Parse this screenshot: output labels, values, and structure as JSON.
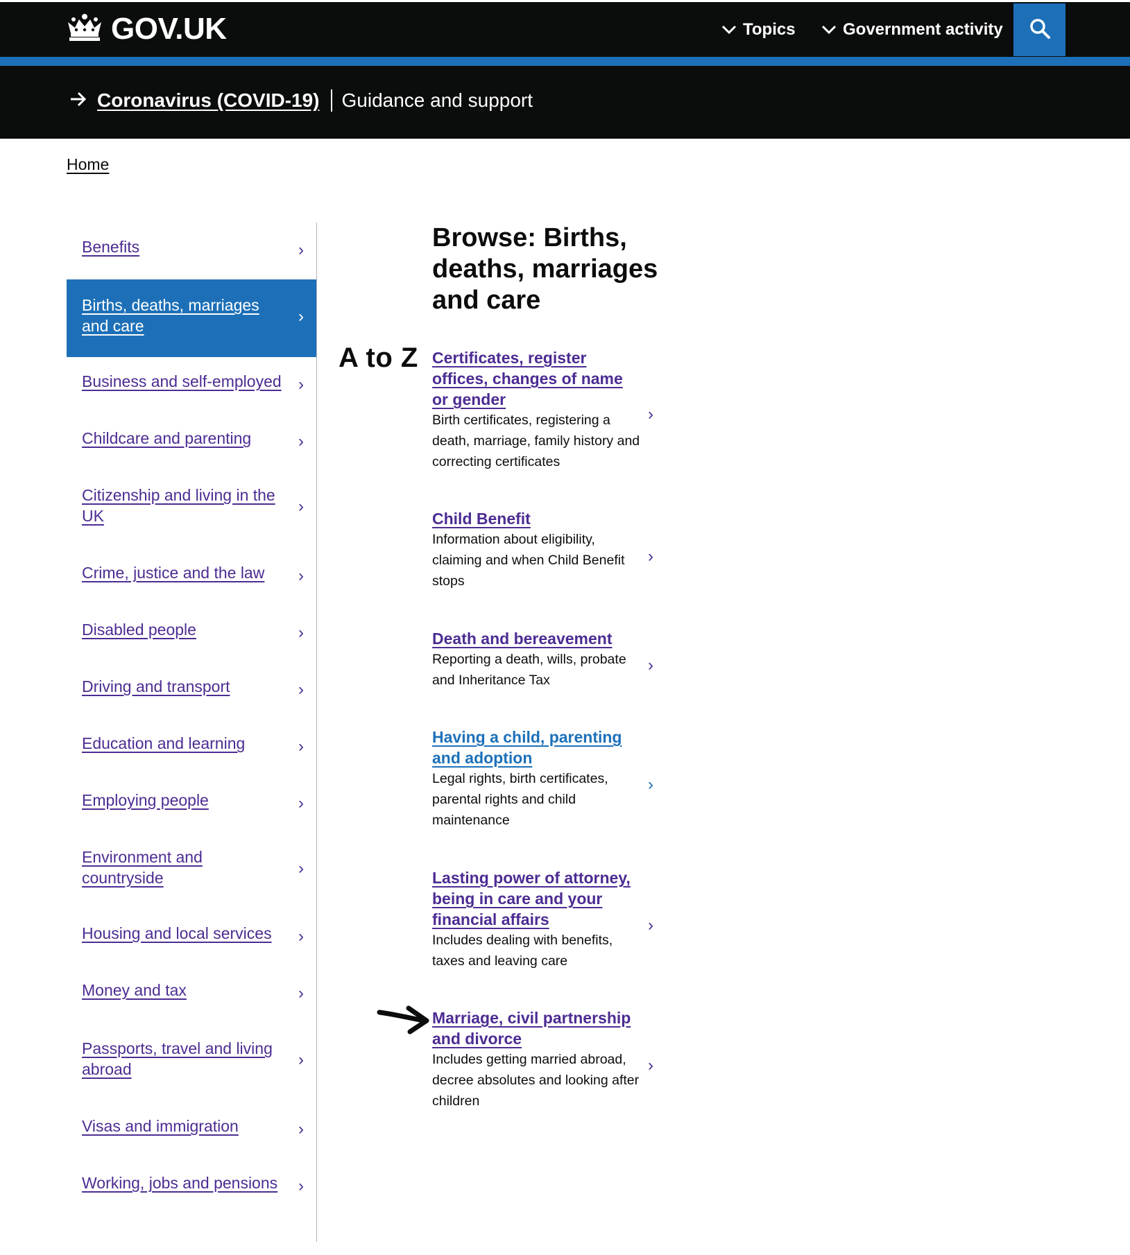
{
  "header": {
    "logo_text": "GOV.UK",
    "nav": [
      {
        "label": "Topics",
        "icon": "chevron-down-icon"
      },
      {
        "label": "Government activity",
        "icon": "chevron-down-icon"
      }
    ],
    "search_icon": "search-icon",
    "colors": {
      "bar": "#0b0c0c",
      "accent": "#1d70b8"
    }
  },
  "covid_banner": {
    "link_text": "Coronavirus (COVID-19)",
    "subtext": "Guidance and support"
  },
  "breadcrumb": {
    "home": "Home"
  },
  "sidebar": {
    "items": [
      {
        "label": "Benefits",
        "active": false
      },
      {
        "label": "Births, deaths, marriages and care",
        "active": true
      },
      {
        "label": "Business and self-employed",
        "active": false
      },
      {
        "label": "Childcare and parenting",
        "active": false
      },
      {
        "label": "Citizenship and living in the UK",
        "active": false
      },
      {
        "label": "Crime, justice and the law",
        "active": false
      },
      {
        "label": "Disabled people",
        "active": false
      },
      {
        "label": "Driving and transport",
        "active": false
      },
      {
        "label": "Education and learning",
        "active": false
      },
      {
        "label": "Employing people",
        "active": false
      },
      {
        "label": "Environment and countryside",
        "active": false
      },
      {
        "label": "Housing and local services",
        "active": false
      },
      {
        "label": "Money and tax",
        "active": false
      },
      {
        "label": "Passports, travel and living abroad",
        "active": false
      },
      {
        "label": "Visas and immigration",
        "active": false
      },
      {
        "label": "Working, jobs and pensions",
        "active": false
      }
    ],
    "chevron": "›"
  },
  "main": {
    "title": "Browse: Births, deaths, marriages and care",
    "atoz": "A to Z",
    "topics": [
      {
        "title": "Certificates, register offices, changes of name or gender",
        "desc": "Birth certificates, registering a death, marriage, family history and correcting certificates"
      },
      {
        "title": "Child Benefit",
        "desc": "Information about eligibility, claiming and when Child Benefit stops"
      },
      {
        "title": "Death and bereavement",
        "desc": "Reporting a death, wills, probate and Inheritance Tax"
      },
      {
        "title": "Having a child, parenting and adoption",
        "desc": "Legal rights, birth certificates, parental rights and child maintenance"
      },
      {
        "title": "Lasting power of attorney, being in care and your financial affairs",
        "desc": "Includes dealing with benefits, taxes and leaving care"
      },
      {
        "title": "Marriage, civil partnership and divorce",
        "desc": "Includes getting married abroad, decree absolutes and looking after children"
      }
    ],
    "colors": {
      "visited_link": "#4c2c92",
      "link": "#1d70b8",
      "text": "#0b0c0c"
    }
  }
}
